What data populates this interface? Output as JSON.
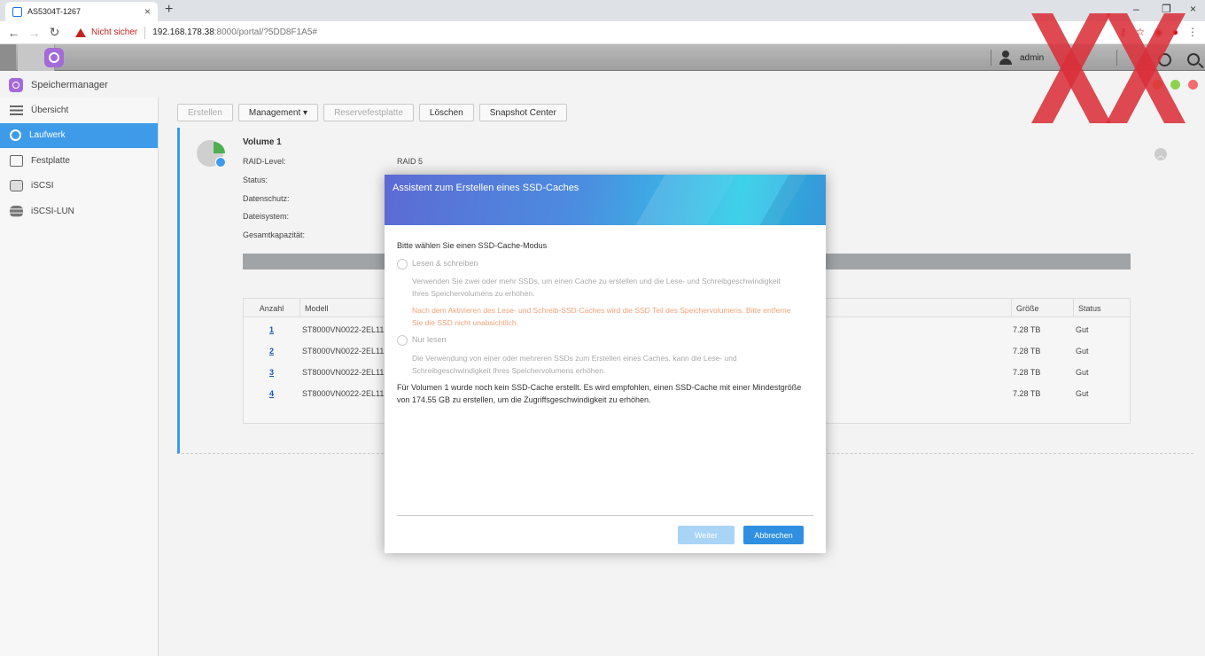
{
  "browser": {
    "tab_title": "AS5304T-1267",
    "security_label": "Nicht sicher",
    "url_host": "192.168.178.38",
    "url_rest": ":8000/portal/?5DD8F1A5#"
  },
  "topbar": {
    "username": "admin"
  },
  "app": {
    "title": "Speichermanager"
  },
  "sidebar": {
    "items": [
      {
        "label": "Übersicht"
      },
      {
        "label": "Laufwerk"
      },
      {
        "label": "Festplatte"
      },
      {
        "label": "iSCSI"
      },
      {
        "label": "iSCSI-LUN"
      }
    ]
  },
  "toolbar": {
    "create": "Erstellen",
    "management": "Management ▾",
    "spare": "Reservefestplatte",
    "delete": "Löschen",
    "snapshot": "Snapshot Center"
  },
  "volume": {
    "name": "Volume 1",
    "raid_label": "RAID-Level:",
    "raid_value": "RAID 5",
    "status_label": "Status:",
    "protection_label": "Datenschutz:",
    "fs_label": "Dateisystem:",
    "capacity_label": "Gesamtkapazität:"
  },
  "disk_table": {
    "headers": {
      "count": "Anzahl",
      "model": "Modell",
      "size": "Größe",
      "status": "Status"
    },
    "rows": [
      {
        "num": "1",
        "model": "ST8000VN0022-2EL112",
        "size": "7.28 TB",
        "status": "Gut"
      },
      {
        "num": "2",
        "model": "ST8000VN0022-2EL112",
        "size": "7.28 TB",
        "status": "Gut"
      },
      {
        "num": "3",
        "model": "ST8000VN0022-2EL112",
        "size": "7.28 TB",
        "status": "Gut"
      },
      {
        "num": "4",
        "model": "ST8000VN0022-2EL112",
        "size": "7.28 TB",
        "status": "Gut"
      }
    ]
  },
  "modal": {
    "title": "Assistent zum Erstellen eines SSD-Caches",
    "prompt": "Bitte wählen Sie einen SSD-Cache-Modus",
    "rw_label": "Lesen & schreiben",
    "rw_desc_1": "Verwenden Sie zwei oder mehr SSDs, um einen Cache zu erstellen und die Lese- und Schreibgeschwindigkeit",
    "rw_desc_2": "Ihres Speichervolumens zu erhöhen.",
    "rw_warn_1": "Nach dem Aktivieren des Lese- und Schreib-SSD-Caches wird die SSD Teil des Speichervolumens. Bitte entferne",
    "rw_warn_2": "Sie die SSD nicht unabsichtlich.",
    "ro_label": "Nur lesen",
    "ro_desc_1": "Die Verwendung von einer oder mehreren SSDs zum Erstellen eines Caches, kann die Lese- und",
    "ro_desc_2": "Schreibgeschwindigkeit Ihres Speichervolumens erhöhen.",
    "note_1": "Für Volumen 1 wurde noch kein SSD-Cache erstellt. Es wird empfohlen, einen SSD-Cache mit einer Mindestgröße",
    "note_2": "von 174.55 GB zu erstellen, um die Zugriffsgeschwindigkeit zu erhöhen.",
    "next": "Weiter",
    "cancel": "Abbrechen"
  },
  "colors": {
    "accent": "#3d9be9",
    "primary_button": "#2f8fe0",
    "warning_text": "#f0a27a",
    "watermark": "#d9303a"
  }
}
